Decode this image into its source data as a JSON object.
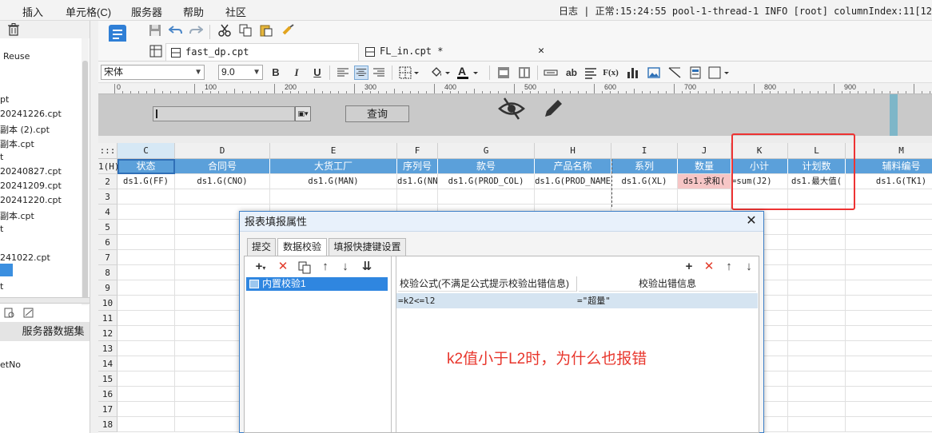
{
  "menubar": {
    "items": [
      "插入",
      "单元格(C)",
      "服务器",
      "帮助",
      "社区"
    ],
    "log_text": "日志 | 正常:15:24:55 pool-1-thread-1 INFO [root] columnIndex:11[12"
  },
  "left_panel": {
    "files": [
      "Reuse",
      "pt",
      "20241226.cpt",
      "副本 (2).cpt",
      "副本.cpt",
      "t",
      "20240827.cpt",
      "20241209.cpt",
      "20241220.cpt",
      "副本.cpt",
      "t",
      "241022.cpt",
      "t"
    ],
    "datasource_button": "服务器数据集",
    "bottom_item": "etNo"
  },
  "tabs": [
    {
      "label": "fast_dp.cpt",
      "active": true
    },
    {
      "label": "FL_in.cpt *",
      "active": false
    }
  ],
  "format_toolbar": {
    "font_name": "宋体",
    "font_size": "9.0",
    "bold": "B",
    "italic": "I",
    "underline": "U",
    "ab": "ab",
    "fx": "F(x)"
  },
  "ruler": {
    "labels": [
      "0",
      "100",
      "200",
      "300",
      "400",
      "500",
      "600",
      "700",
      "800",
      "900"
    ]
  },
  "param_panel": {
    "query_button": "查询"
  },
  "grid": {
    "corner": ":::",
    "columns": [
      "C",
      "D",
      "E",
      "F",
      "G",
      "H",
      "I",
      "J",
      "K",
      "L",
      "M"
    ],
    "selected_column": "C",
    "rows": [
      "1(H)",
      "2",
      "3",
      "4",
      "5",
      "6",
      "7",
      "8",
      "9",
      "10",
      "11",
      "12",
      "13",
      "14",
      "15",
      "16",
      "17",
      "18"
    ],
    "header_row": [
      "状态",
      "合同号",
      "大货工厂",
      "序列号",
      "款号",
      "产品名称",
      "系列",
      "数量",
      "小计",
      "计划数",
      "辅料编号"
    ],
    "data_row": [
      "ds1.G(FF)",
      "ds1.G(CNO)",
      "ds1.G(MAN)",
      "ds1.G(NN",
      "ds1.G(PROD_COL)",
      "ds1.G(PROD_NAME",
      "ds1.G(XL)",
      "ds1.求和(",
      "=sum(J2)",
      "ds1.最大值(",
      "ds1.G(TK1)"
    ]
  },
  "dialog": {
    "title": "报表填报属性",
    "close": "✕",
    "tabs": [
      "提交",
      "数据校验",
      "填报快捷键设置"
    ],
    "active_tab": "数据校验",
    "tree_item": "内置校验1",
    "columns": [
      "校验公式(不满足公式提示校验出错信息)",
      "校验出错信息"
    ],
    "rows": [
      {
        "formula": "=k2<=l2",
        "message": "=\"超量\""
      }
    ],
    "annotation": "k2值小于L2时，为什么也报错"
  },
  "colors": {
    "header_blue": "#5ba0da",
    "selection_blue": "#2f86e0",
    "highlight_red": "#e33333",
    "pink_cell": "#f6c6c6"
  }
}
